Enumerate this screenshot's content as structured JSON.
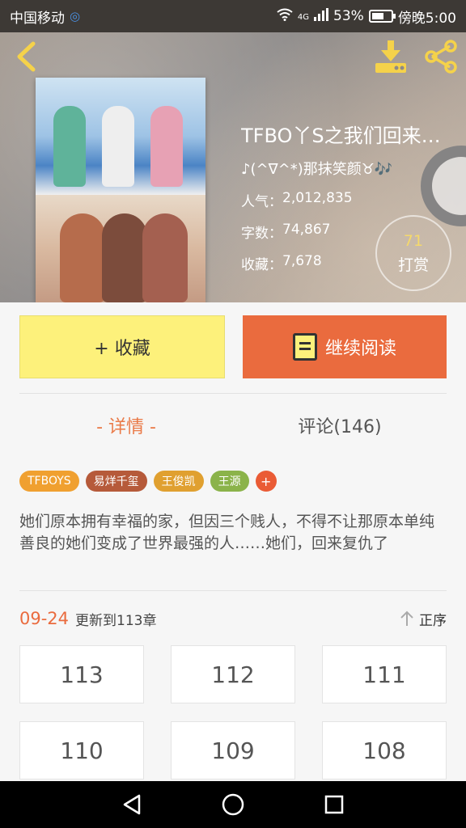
{
  "status_bar": {
    "carrier": "中国移动",
    "network": "4G",
    "battery": "53%",
    "time": "傍晚5:00"
  },
  "book": {
    "title": "TFBO丫S之我们回来…",
    "author": "♪(^∇^*)那抹笑颜♉🎶",
    "stats": [
      {
        "label": "人气：",
        "value": "2,012,835"
      },
      {
        "label": "字数：",
        "value": "74,867"
      },
      {
        "label": "收藏：",
        "value": "7,678"
      }
    ],
    "tip": {
      "count": "71",
      "label": "打赏"
    }
  },
  "actions": {
    "favorite": "+ 收藏",
    "continue": "继续阅读"
  },
  "tabs": {
    "detail": "- 详情 -",
    "comments": "评论(146)"
  },
  "tags": [
    {
      "label": "TFBOYS",
      "color": "#f0a030"
    },
    {
      "label": "易烊千玺",
      "color": "#b65a3a"
    },
    {
      "label": "王俊凯",
      "color": "#e0a030"
    },
    {
      "label": "王源",
      "color": "#8bb34a"
    }
  ],
  "tag_add": "+",
  "summary": "她们原本拥有幸福的家，但因三个贱人，不得不让那原本单纯善良的她们变成了世界最强的人……她们，回来复仇了",
  "update": {
    "date": "09-24",
    "text": "更新到113章",
    "sort": "正序"
  },
  "chapters": [
    "113",
    "112",
    "111",
    "110",
    "109",
    "108"
  ],
  "colors": {
    "accent": "#ea6b3e",
    "favorite_bg": "#fdf17b",
    "tip_count": "#f5d96b"
  }
}
